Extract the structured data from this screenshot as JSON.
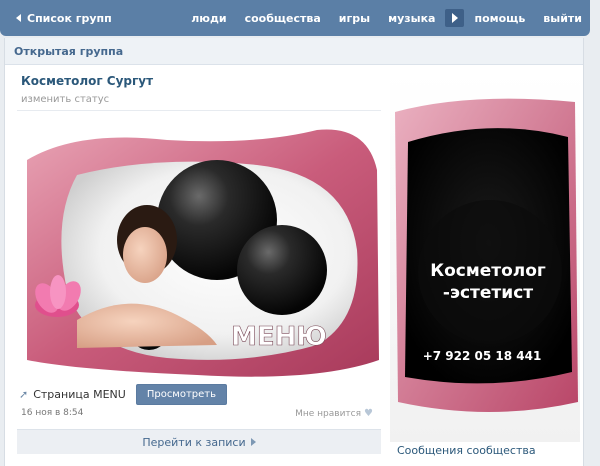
{
  "topbar": {
    "back_label": "Список групп",
    "nav": [
      "люди",
      "сообщества",
      "игры",
      "музыка",
      "помощь",
      "выйти"
    ]
  },
  "panel": {
    "header": "Открытая группа",
    "group_title": "Косметолог Сургут",
    "status_link": "изменить статус"
  },
  "banner": {
    "text": "МЕНЮ"
  },
  "side_banner": {
    "line1": "Косметолог",
    "line2": "-эстетист",
    "phone": "+7 922 05 18 441"
  },
  "post": {
    "page_label": "Страница MENU",
    "view_button": "Просмотреть",
    "date": "16 ноя в 8:54",
    "like_label": "Мне нравится",
    "goto_label": "Перейти к записи"
  },
  "sidebar": {
    "messages_link": "Сообщения сообщества"
  },
  "colors": {
    "topbar": "#5b7fa6",
    "link": "#2b587a",
    "accent_pink": "#c0456a"
  }
}
